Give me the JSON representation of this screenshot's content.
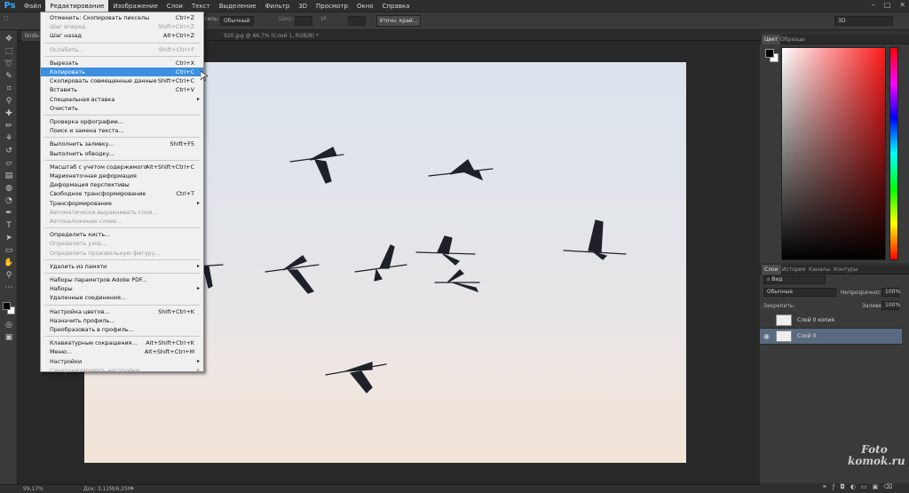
{
  "app": {
    "logo": "Ps"
  },
  "menubar": {
    "items": [
      "Файл",
      "Редактирование",
      "Изображение",
      "Слои",
      "Текст",
      "Выделение",
      "Фильтр",
      "3D",
      "Просмотр",
      "Окно",
      "Справка"
    ],
    "active_index": 1,
    "window_controls": [
      "–",
      "□",
      "✕"
    ]
  },
  "options": {
    "style_label": "тиль:",
    "style_value": "Обычный",
    "width_label": "Шир.:",
    "refine_button": "Уточн. край...",
    "workspace": "3D"
  },
  "document": {
    "tab1": "birds-",
    "tab2": "920.jpg @ 66,7% (Слой 1, RGB/8) *"
  },
  "status": {
    "zoom": "99,17%",
    "doc": "Док: 3,12M/6,25M"
  },
  "color_panel": {
    "tabs": [
      "Цвет",
      "Образцы"
    ],
    "foreground": "#000000",
    "background": "#ffffff",
    "hue": "#ff1a1a"
  },
  "layers_panel": {
    "tabs": [
      "Слои",
      "История",
      "Каналы",
      "Контуры"
    ],
    "kind": "Вид",
    "blend_mode": "Обычные",
    "opacity_label": "Непрозрачность:",
    "opacity": "100%",
    "lock_label": "Закрепить:",
    "fill_label": "Заливка:",
    "fill": "100%",
    "layers": [
      {
        "name": "Слой 0 копия",
        "visible": false,
        "selected": false
      },
      {
        "name": "Слой 0",
        "visible": true,
        "selected": true
      }
    ]
  },
  "watermark": {
    "line1": "Foto",
    "line2": "komok.ru"
  },
  "edit_menu": [
    {
      "label": "Отменить: Скопировать пикселы",
      "shortcut": "Ctrl+Z"
    },
    {
      "label": "Шаг вперед",
      "shortcut": "Shift+Ctrl+Z",
      "disabled": true
    },
    {
      "label": "Шаг назад",
      "shortcut": "Alt+Ctrl+Z"
    },
    {
      "separator": true
    },
    {
      "label": "Ослабить...",
      "shortcut": "Shift+Ctrl+F",
      "disabled": true
    },
    {
      "separator": true
    },
    {
      "label": "Вырезать",
      "shortcut": "Ctrl+X"
    },
    {
      "label": "Копировать",
      "shortcut": "Ctrl+C",
      "highlighted": true
    },
    {
      "label": "Скопировать совмещенные данные",
      "shortcut": "Shift+Ctrl+C"
    },
    {
      "label": "Вставить",
      "shortcut": "Ctrl+V"
    },
    {
      "label": "Специальная вставка",
      "submenu": true
    },
    {
      "label": "Очистить"
    },
    {
      "separator": true
    },
    {
      "label": "Проверка орфографии..."
    },
    {
      "label": "Поиск и замена текста..."
    },
    {
      "separator": true
    },
    {
      "label": "Выполнить заливку...",
      "shortcut": "Shift+F5"
    },
    {
      "label": "Выполнить обводку..."
    },
    {
      "separator": true
    },
    {
      "label": "Масштаб с учетом содержимого",
      "shortcut": "Alt+Shift+Ctrl+C"
    },
    {
      "label": "Марионеточная деформация"
    },
    {
      "label": "Деформация перспективы"
    },
    {
      "label": "Свободное трансформирование",
      "shortcut": "Ctrl+T"
    },
    {
      "label": "Трансформирование",
      "submenu": true
    },
    {
      "label": "Автоматически выравнивать слои...",
      "disabled": true
    },
    {
      "label": "Автоналожение слоев...",
      "disabled": true
    },
    {
      "separator": true
    },
    {
      "label": "Определить кисть..."
    },
    {
      "label": "Определить узор...",
      "disabled": true
    },
    {
      "label": "Определить произвольную фигуру...",
      "disabled": true
    },
    {
      "separator": true
    },
    {
      "label": "Удалить из памяти",
      "submenu": true
    },
    {
      "separator": true
    },
    {
      "label": "Наборы параметров Adobe PDF..."
    },
    {
      "label": "Наборы",
      "submenu": true
    },
    {
      "label": "Удаленные соединения..."
    },
    {
      "separator": true
    },
    {
      "label": "Настройка цветов...",
      "shortcut": "Shift+Ctrl+K"
    },
    {
      "label": "Назначить профиль..."
    },
    {
      "label": "Преобразовать в профиль..."
    },
    {
      "separator": true
    },
    {
      "label": "Клавиатурные сокращения...",
      "shortcut": "Alt+Shift+Ctrl+K"
    },
    {
      "label": "Меню...",
      "shortcut": "Alt+Shift+Ctrl+M"
    },
    {
      "label": "Настройки",
      "submenu": true
    },
    {
      "label": "Синхронизировать настройки",
      "submenu": true,
      "disabled": true
    }
  ]
}
